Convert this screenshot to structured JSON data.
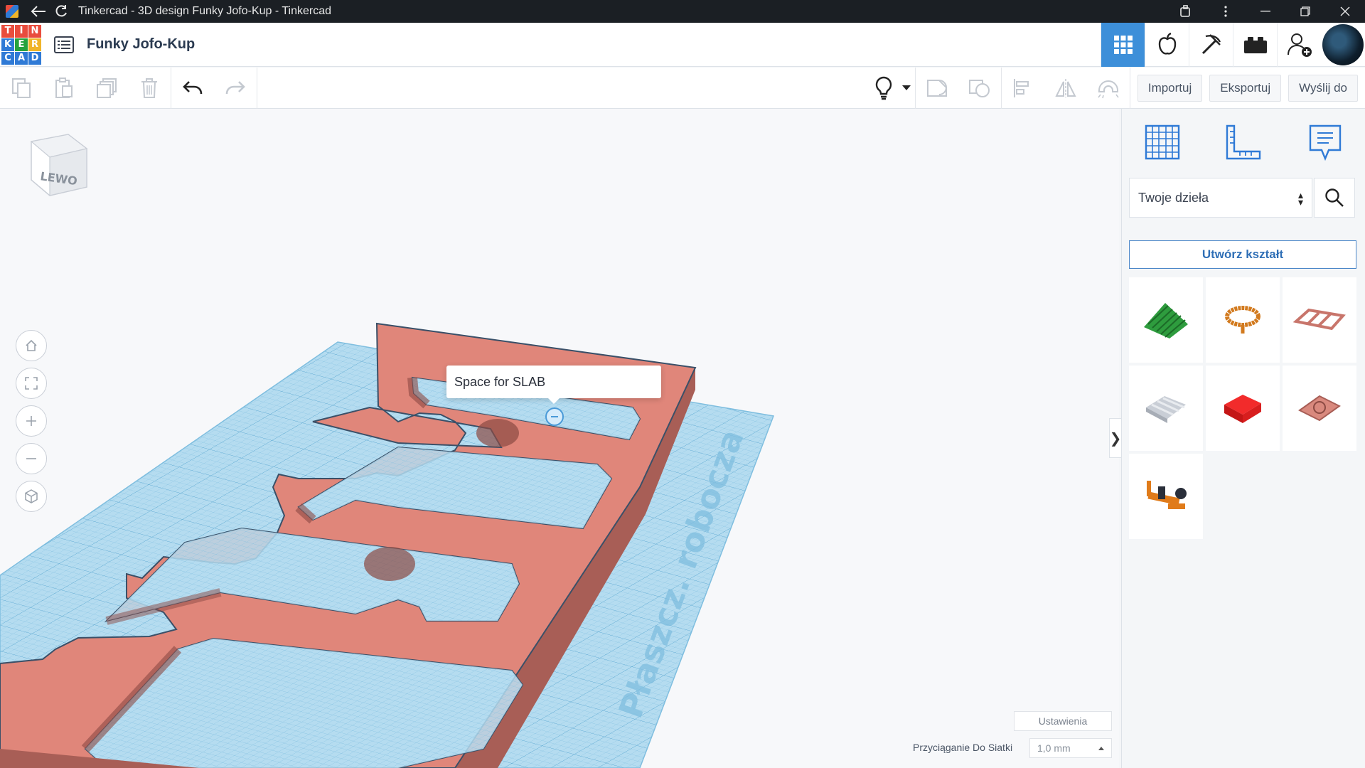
{
  "window": {
    "title": "Tinkercad - 3D design Funky Jofo-Kup - Tinkercad"
  },
  "header": {
    "logo_letters": [
      "T",
      "I",
      "N",
      "K",
      "E",
      "R",
      "C",
      "A",
      "D"
    ],
    "design_name": "Funky Jofo-Kup"
  },
  "toolbar": {
    "import_label": "Importuj",
    "export_label": "Eksportuj",
    "send_label": "Wyślij do"
  },
  "workspace": {
    "viewcube_label": "LEWO",
    "workplane_text": "Płaszcz. robocza",
    "tooltip_text": "Space for SLAB",
    "settings_label": "Ustawienia",
    "snap_label": "Przyciąganie Do Siatki",
    "snap_value": "1,0 mm"
  },
  "panel": {
    "library_select": "Twoje dzieła",
    "create_shape_label": "Utwórz kształt",
    "collapse_glyph": "❯"
  },
  "colors": {
    "accent": "#3d8fd9",
    "shape": "#e0867a",
    "workplane": "#a9d6ee"
  }
}
